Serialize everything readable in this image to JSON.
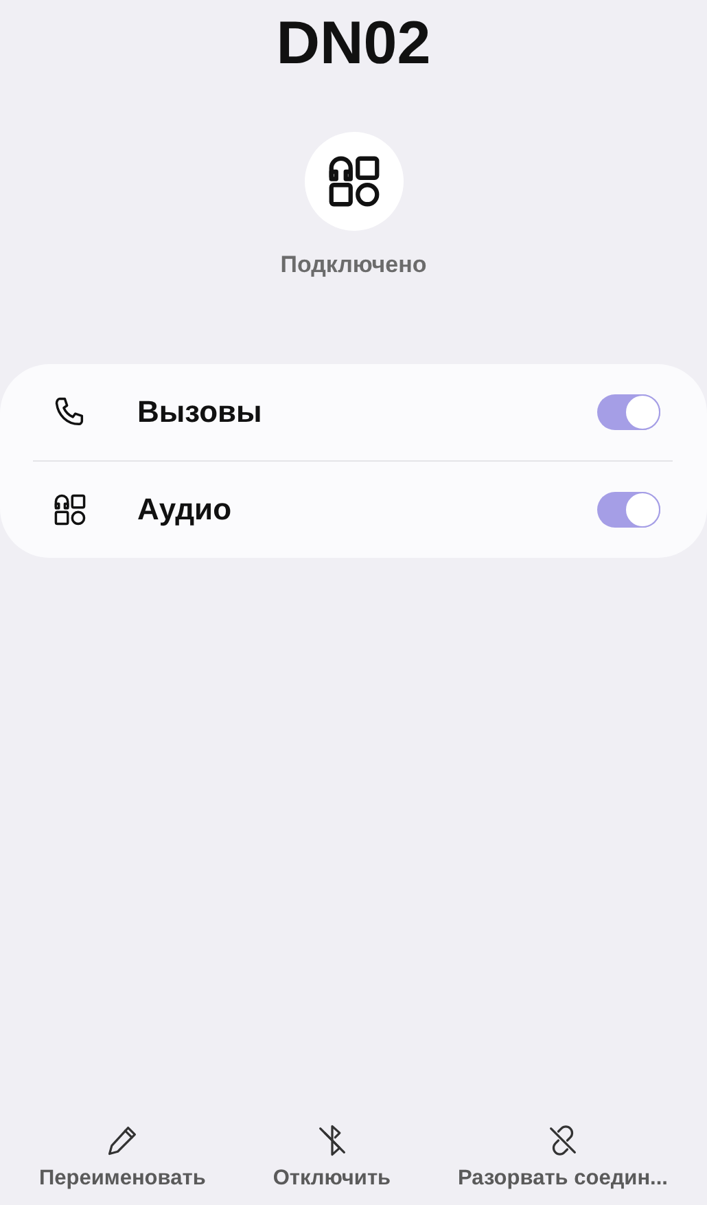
{
  "device": {
    "name": "DN02",
    "status": "Подключено"
  },
  "settings": [
    {
      "kind": "phone",
      "label": "Вызовы",
      "on": true
    },
    {
      "kind": "audio",
      "label": "Аудио",
      "on": true
    }
  ],
  "actions": [
    {
      "kind": "rename",
      "label": "Переименовать"
    },
    {
      "kind": "disconnect",
      "label": "Отключить"
    },
    {
      "kind": "unpair",
      "label": "Разорвать соедин..."
    }
  ]
}
